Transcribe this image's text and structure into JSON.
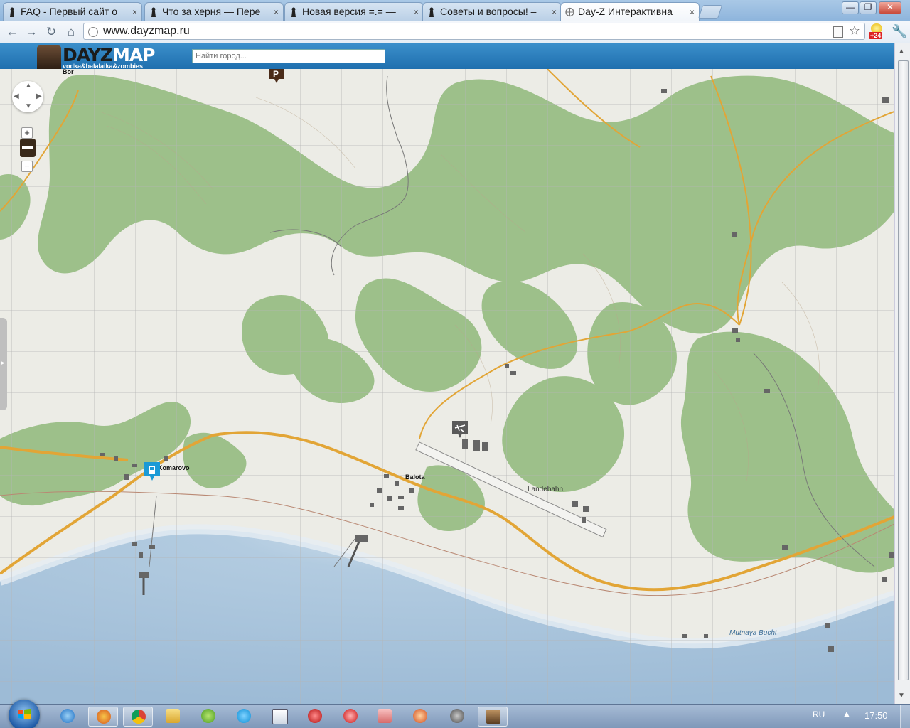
{
  "browser": {
    "tabs": [
      {
        "title": "FAQ - Первый сайт о",
        "favicon": "player-favicon"
      },
      {
        "title": "Что за херня — Пере",
        "favicon": "player-favicon"
      },
      {
        "title": "Новая версия =.= —",
        "favicon": "player-favicon"
      },
      {
        "title": "Советы и вопросы! –",
        "favicon": "player-favicon"
      },
      {
        "title": "Day-Z Интерактивна",
        "favicon": "globe-favicon",
        "active": true
      }
    ],
    "close_glyph": "×",
    "window_controls": {
      "minimize": "—",
      "maximize": "❐",
      "close": "✕"
    },
    "nav": {
      "back": "←",
      "forward": "→",
      "reload": "↻",
      "home": "⌂"
    },
    "url": "www.dayzmap.ru",
    "extension_badge": "+24"
  },
  "site": {
    "logo_dayz": "DAYZ",
    "logo_map": "MAP",
    "tagline": "vodka&balalaika&zombies",
    "search_placeholder": "Найти город..."
  },
  "map": {
    "labels": {
      "bor": "Bor",
      "komarovo": "Komarovo",
      "balota": "Balota",
      "landebahn": "Landebahn",
      "mutnaya_bucht": "Mutnaya Bucht"
    },
    "controls": {
      "zoom_in": "+",
      "zoom_out": "−",
      "pan_up": "▲",
      "pan_down": "▼",
      "pan_left": "◀",
      "pan_right": "▶",
      "side_toggle": "▸"
    },
    "colors": {
      "forest": "#9cc08a",
      "field": "#ecece6",
      "sea": "#a9c6dd",
      "road": "#e2a536",
      "grid": "#b7b7b7"
    },
    "markers": [
      "parking-marker",
      "fuel-station-marker",
      "airfield-marker"
    ]
  },
  "taskbar": {
    "apps": [
      "internet-explorer-icon",
      "firefox-icon",
      "chrome-icon",
      "explorer-folder-icon",
      "utorrent-icon",
      "skype-icon",
      "notepad-icon",
      "calendar-icon",
      "opera-icon",
      "media-player-icon",
      "ccleaner-icon",
      "hp-icon",
      "dayz-icon"
    ],
    "language": "RU",
    "tray_arrow": "▲",
    "time": "17:50"
  }
}
